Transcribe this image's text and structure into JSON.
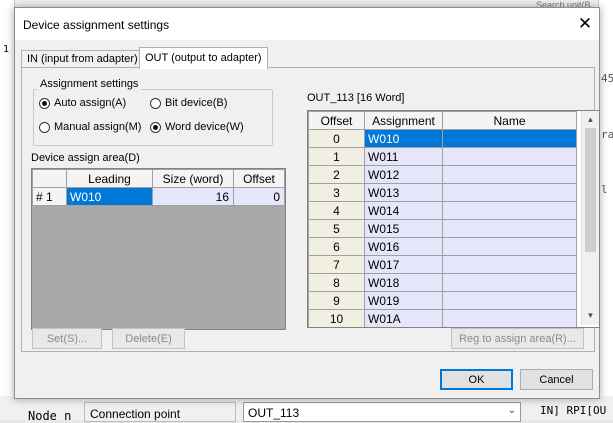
{
  "background": {
    "left_fragment": "1",
    "search_fragment": "Search unit(B",
    "right_fragments": [
      "45",
      "ra",
      "l"
    ],
    "node_label": "Node n",
    "connection_point_label": "Connection point",
    "connection_point_value": "OUT_113",
    "rpi_text": "IN] RPI[OU"
  },
  "dialog": {
    "title": "Device assignment settings",
    "close_icon": "close-icon",
    "tabs": [
      {
        "label": "IN (input from adapter)",
        "selected": false
      },
      {
        "label": "OUT (output to adapter)",
        "selected": true
      }
    ],
    "assignment_settings": {
      "title": "Assignment settings",
      "options": [
        {
          "label": "Auto assign(A)",
          "checked": true
        },
        {
          "label": "Bit device(B)",
          "checked": false
        },
        {
          "label": "Manual assign(M)",
          "checked": false
        },
        {
          "label": "Word device(W)",
          "checked": true
        }
      ]
    },
    "device_assign_area": {
      "label": "Device assign area(D)",
      "columns": [
        "",
        "Leading",
        "Size (word)",
        "Offset"
      ],
      "rows": [
        {
          "index": "# 1",
          "leading": "W010",
          "size": "16",
          "offset": "0"
        }
      ]
    },
    "out_table": {
      "label": "OUT_113 [16 Word]",
      "columns": [
        "Offset",
        "Assignment",
        "Name"
      ],
      "rows": [
        {
          "offset": "0",
          "assignment": "W010",
          "name": ""
        },
        {
          "offset": "1",
          "assignment": "W011",
          "name": ""
        },
        {
          "offset": "2",
          "assignment": "W012",
          "name": ""
        },
        {
          "offset": "3",
          "assignment": "W013",
          "name": ""
        },
        {
          "offset": "4",
          "assignment": "W014",
          "name": ""
        },
        {
          "offset": "5",
          "assignment": "W015",
          "name": ""
        },
        {
          "offset": "6",
          "assignment": "W016",
          "name": ""
        },
        {
          "offset": "7",
          "assignment": "W017",
          "name": ""
        },
        {
          "offset": "8",
          "assignment": "W018",
          "name": ""
        },
        {
          "offset": "9",
          "assignment": "W019",
          "name": ""
        },
        {
          "offset": "10",
          "assignment": "W01A",
          "name": ""
        }
      ]
    },
    "buttons": {
      "set": "Set(S)...",
      "delete": "Delete(E)",
      "reg": "Reg to assign area(R)...",
      "ok": "OK",
      "cancel": "Cancel"
    },
    "colors": {
      "selection": "#0078d7",
      "assigned_cell": "#e6e6fa",
      "offset_cell": "#f1efe2"
    }
  }
}
